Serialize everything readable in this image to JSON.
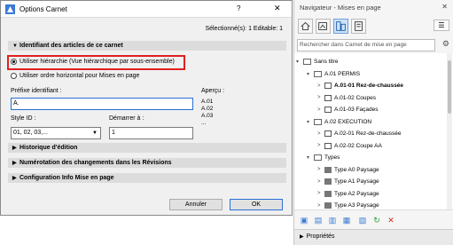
{
  "dialog": {
    "title": "Options Carnet",
    "help": "?",
    "close": "✕",
    "selection_info": "Sélectionné(s): 1 Editable: 1",
    "section_identifiant": "Identifiant des articles de ce carnet",
    "radio_hierarchy": "Utiliser hiérarchie (Vue hiérarchique par sous-ensemble)",
    "radio_horizontal": "Utiliser ordre horizontal pour Mises en page",
    "prefix_label": "Préfixe identifiant :",
    "prefix_value": "A.",
    "style_label": "Style ID :",
    "style_value": "01, 02, 03,...",
    "start_label": "Démarrer à :",
    "start_value": "1",
    "apercu_label": "Aperçu :",
    "apercu_lines": [
      "A.01",
      "A.02",
      "A.03",
      "..."
    ],
    "section_history": "Historique d'édition",
    "section_numbering": "Numérotation des changements dans les Révisions",
    "section_config": "Configuration Info Mise en page",
    "cancel_label": "Annuler",
    "ok_label": "OK"
  },
  "navigator": {
    "title": "Navigateur - Mises en page",
    "search_placeholder": "Rechercher dans Carnet de mise en page",
    "menu_glyph": "☰",
    "tree": [
      {
        "label": "Sans titre",
        "level": 0,
        "twisty": "▾",
        "type": "book"
      },
      {
        "label": "A.01 PERMIS",
        "level": 1,
        "twisty": "▾",
        "type": "folder"
      },
      {
        "label": "A.01-01 Rez-de-chaussée",
        "level": 2,
        "twisty": ">",
        "type": "layout",
        "bold": true
      },
      {
        "label": "A.01-02 Coupes",
        "level": 2,
        "twisty": ">",
        "type": "layout"
      },
      {
        "label": "A.01-03 Façades",
        "level": 2,
        "twisty": ">",
        "type": "layout"
      },
      {
        "label": "A.02 EXECUTION",
        "level": 1,
        "twisty": "▾",
        "type": "folder"
      },
      {
        "label": "A.02-01 Rez-de-chaussée",
        "level": 2,
        "twisty": ">",
        "type": "layout"
      },
      {
        "label": "A.02-02 Coupe AA",
        "level": 2,
        "twisty": ">",
        "type": "layout"
      },
      {
        "label": "Types",
        "level": 1,
        "twisty": "▾",
        "type": "folder"
      },
      {
        "label": "Type A0 Paysage",
        "level": 2,
        "twisty": ">",
        "type": "master"
      },
      {
        "label": "Type A1 Paysage",
        "level": 2,
        "twisty": ">",
        "type": "master"
      },
      {
        "label": "Type A2 Paysage",
        "level": 2,
        "twisty": ">",
        "type": "master"
      },
      {
        "label": "Type A3 Paysage",
        "level": 2,
        "twisty": ">",
        "type": "master"
      }
    ],
    "properties_label": "Propriétés"
  }
}
